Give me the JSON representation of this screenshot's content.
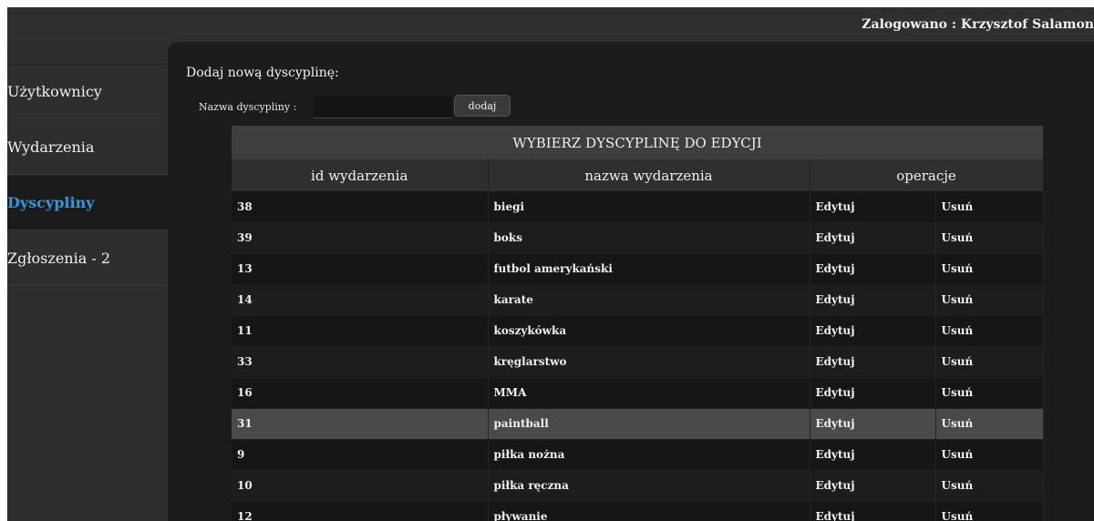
{
  "header": {
    "login_text": "Zalogowano : Krzysztof  Salamon"
  },
  "sidebar": {
    "items": [
      {
        "label": "Użytkownicy"
      },
      {
        "label": "Wydarzenia"
      },
      {
        "label": "Dyscypliny",
        "active": true
      },
      {
        "label": "Zgłoszenia - 2"
      }
    ]
  },
  "add_form": {
    "title": "Dodaj nową dyscyplinę:",
    "field_label": "Nazwa dyscypliny :",
    "field_value": "",
    "button_label": "dodaj"
  },
  "table": {
    "caption": "WYBIERZ DYSCYPLINĘ DO EDYCJI",
    "headers": [
      "id wydarzenia",
      "nazwa wydarzenia",
      "operacje"
    ],
    "rows": [
      {
        "id": "38",
        "name": "biegi",
        "edit": "Edytuj",
        "delete": "Usuń"
      },
      {
        "id": "39",
        "name": "boks",
        "edit": "Edytuj",
        "delete": "Usuń"
      },
      {
        "id": "13",
        "name": "futbol amerykański",
        "edit": "Edytuj",
        "delete": "Usuń"
      },
      {
        "id": "14",
        "name": "karate",
        "edit": "Edytuj",
        "delete": "Usuń"
      },
      {
        "id": "11",
        "name": "koszykówka",
        "edit": "Edytuj",
        "delete": "Usuń"
      },
      {
        "id": "33",
        "name": "kręglarstwo",
        "edit": "Edytuj",
        "delete": "Usuń"
      },
      {
        "id": "16",
        "name": "MMA",
        "edit": "Edytuj",
        "delete": "Usuń"
      },
      {
        "id": "31",
        "name": "paintball",
        "edit": "Edytuj",
        "delete": "Usuń"
      },
      {
        "id": "9",
        "name": "piłka nożna",
        "edit": "Edytuj",
        "delete": "Usuń"
      },
      {
        "id": "10",
        "name": "piłka ręczna",
        "edit": "Edytuj",
        "delete": "Usuń"
      },
      {
        "id": "12",
        "name": "pływanie",
        "edit": "Edytuj",
        "delete": "Usuń"
      }
    ],
    "highlighted_row_index": 7
  },
  "colors": {
    "active_link": "#2f9ad6",
    "background": "#2d2d2d",
    "content_bg": "#1c1c1c",
    "highlight_row": "#4a4a4a"
  }
}
